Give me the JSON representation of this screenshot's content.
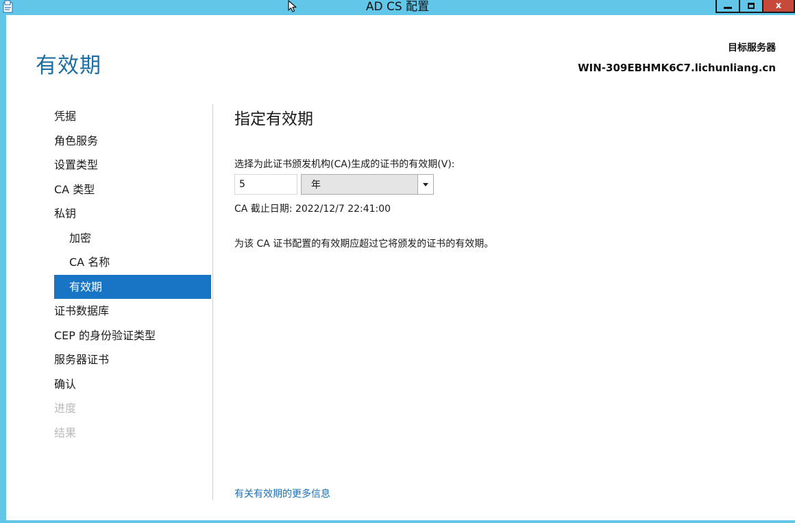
{
  "window": {
    "title": "AD CS 配置",
    "controls": {
      "minimize": "minimize",
      "maximize": "maximize",
      "close": "x"
    },
    "colors": {
      "frame": "#62c6e9",
      "close_button": "#c7493a",
      "accent": "#1874c4",
      "title_text": "#1e6ea0",
      "link": "#1a6fb8"
    }
  },
  "header": {
    "page_title": "有效期",
    "target_server_label": "目标服务器",
    "target_server_name": "WIN-309EBHMK6C7.lichunliang.cn"
  },
  "nav": {
    "items": [
      {
        "label": "凭据",
        "state": "normal",
        "level": 0
      },
      {
        "label": "角色服务",
        "state": "normal",
        "level": 0
      },
      {
        "label": "设置类型",
        "state": "normal",
        "level": 0
      },
      {
        "label": "CA 类型",
        "state": "normal",
        "level": 0
      },
      {
        "label": "私钥",
        "state": "normal",
        "level": 0
      },
      {
        "label": "加密",
        "state": "normal",
        "level": 1
      },
      {
        "label": "CA 名称",
        "state": "normal",
        "level": 1
      },
      {
        "label": "有效期",
        "state": "active",
        "level": 1
      },
      {
        "label": "证书数据库",
        "state": "normal",
        "level": 0
      },
      {
        "label": "CEP 的身份验证类型",
        "state": "normal",
        "level": 0
      },
      {
        "label": "服务器证书",
        "state": "normal",
        "level": 0
      },
      {
        "label": "确认",
        "state": "normal",
        "level": 0
      },
      {
        "label": "进度",
        "state": "disabled",
        "level": 0
      },
      {
        "label": "结果",
        "state": "disabled",
        "level": 0
      }
    ]
  },
  "main": {
    "section_title": "指定有效期",
    "validity_label": "选择为此证书颁发机构(CA)生成的证书的有效期(V):",
    "validity_value": "5",
    "unit_selected": "年",
    "expiry_text": "CA 截止日期: 2022/12/7 22:41:00",
    "note": "为该 CA 证书配置的有效期应超过它将颁发的证书的有效期。",
    "more_info_link": "有关有效期的更多信息"
  }
}
